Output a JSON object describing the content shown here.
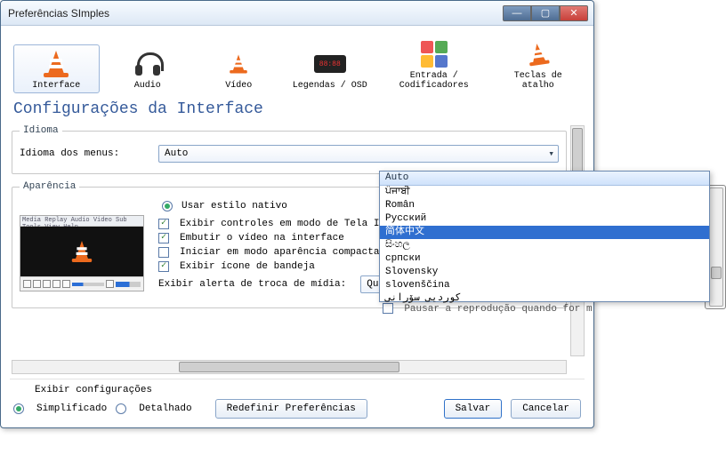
{
  "window": {
    "title": "Preferências SImples"
  },
  "tabs": {
    "interface": "Interface",
    "audio": "Audio",
    "video": "Vídeo",
    "subtitles": "Legendas / OSD",
    "input": "Entrada / Codificadores",
    "hotkeys": "Teclas de atalho"
  },
  "section_title": "Configurações da Interface",
  "language": {
    "legend": "Idioma",
    "label": "Idioma dos menus:",
    "selected": "Auto"
  },
  "appearance": {
    "legend": "Aparência",
    "native_style": "Usar estilo nativo",
    "preview_menubar": "Media Replay Audio Video Sub Tools View Help",
    "show_fullscreen_controls": "Exibir controles em modo de Tela Intei",
    "embed_video": "Embutir o vídeo na interface",
    "start_compact": "Iniciar em modo aparência compacta",
    "show_tray": "Exibir ícone de bandeja",
    "media_change_alert": "Exibir alerta de troca de mídia:",
    "media_change_value": "Quando minimizado",
    "hidden_pause_text": "Pausar a reprodução quando for m"
  },
  "footer": {
    "show_settings": "Exibir configurações",
    "simple": "Simplificado",
    "detailed": "Detalhado",
    "reset": "Redefinir Preferências",
    "save": "Salvar",
    "cancel": "Cancelar"
  },
  "dropdown": {
    "header": "Auto",
    "items": [
      "ਪੰਜਾਬੀ",
      "Român",
      "Русский",
      "简体中文",
      "සිංහල",
      "српски",
      "Slovensky",
      "slovenščina",
      "کوردیی سۆرانی"
    ],
    "selected_index": 3
  }
}
